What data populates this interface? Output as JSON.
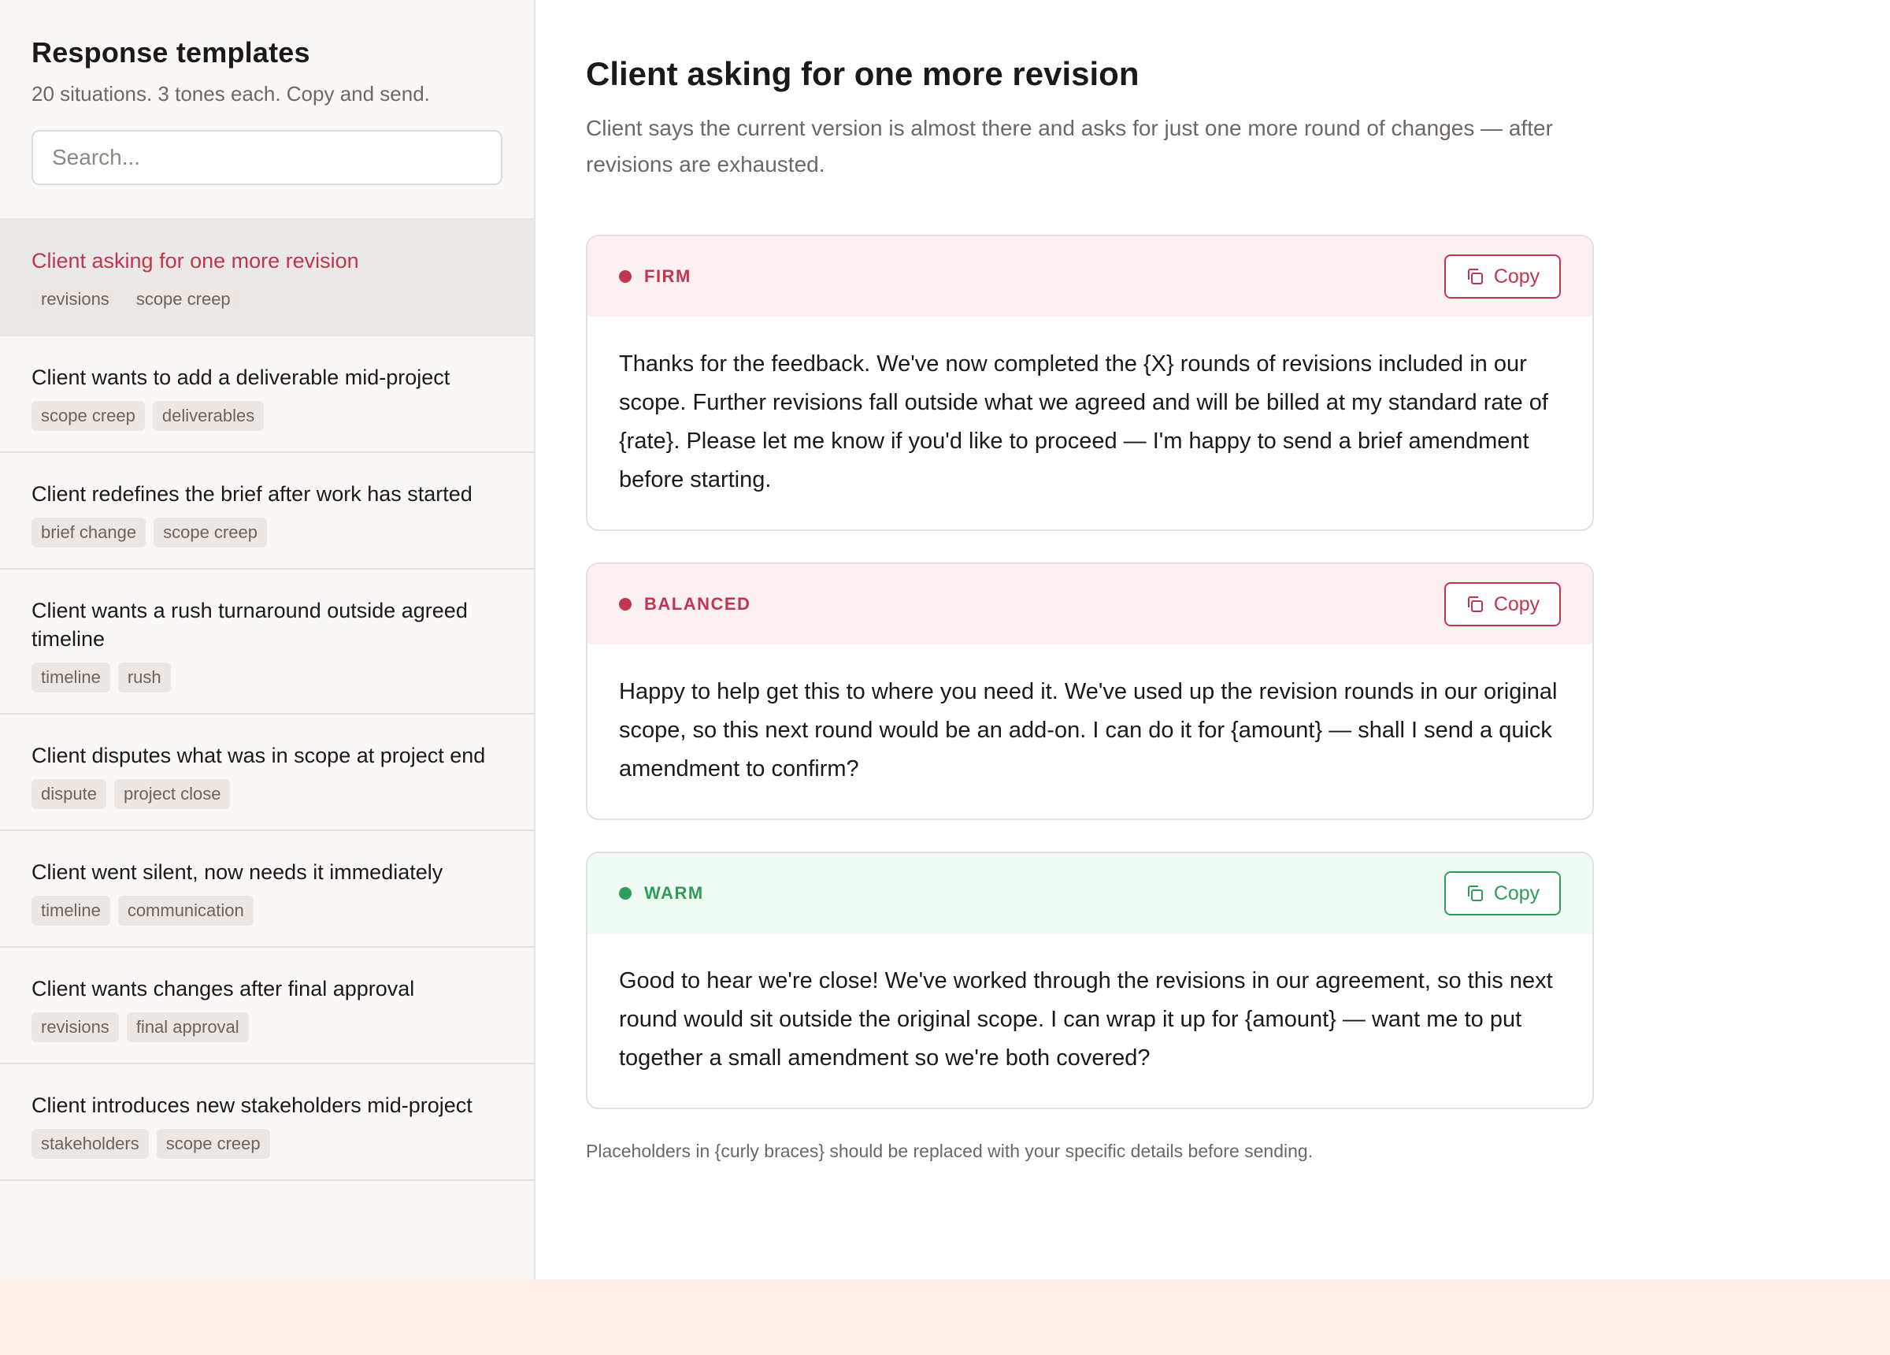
{
  "sidebar": {
    "title": "Response templates",
    "subtitle": "20 situations. 3 tones each. Copy and send.",
    "search_placeholder": "Search...",
    "items": [
      {
        "title": "Client asking for one more revision",
        "tags": [
          "revisions",
          "scope creep"
        ],
        "active": true
      },
      {
        "title": "Client wants to add a deliverable mid-project",
        "tags": [
          "scope creep",
          "deliverables"
        ]
      },
      {
        "title": "Client redefines the brief after work has started",
        "tags": [
          "brief change",
          "scope creep"
        ]
      },
      {
        "title": "Client wants a rush turnaround outside agreed timeline",
        "tags": [
          "timeline",
          "rush"
        ]
      },
      {
        "title": "Client disputes what was in scope at project end",
        "tags": [
          "dispute",
          "project close"
        ]
      },
      {
        "title": "Client went silent, now needs it immediately",
        "tags": [
          "timeline",
          "communication"
        ]
      },
      {
        "title": "Client wants changes after final approval",
        "tags": [
          "revisions",
          "final approval"
        ]
      },
      {
        "title": "Client introduces new stakeholders mid-project",
        "tags": [
          "stakeholders",
          "scope creep"
        ]
      }
    ]
  },
  "main": {
    "title": "Client asking for one more revision",
    "description": "Client says the current version is almost there and asks for just one more round of changes — after revisions are exhausted.",
    "copy_label": "Copy",
    "cards": [
      {
        "tone": "FIRM",
        "text": "Thanks for the feedback. We've now completed the {X} rounds of revisions included in our scope. Further revisions fall outside what we agreed and will be billed at my standard rate of {rate}. Please let me know if you'd like to proceed — I'm happy to send a brief amendment before starting."
      },
      {
        "tone": "BALANCED",
        "text": "Happy to help get this to where you need it. We've used up the revision rounds in our original scope, so this next round would be an add-on. I can do it for {amount} — shall I send a quick amendment to confirm?"
      },
      {
        "tone": "WARM",
        "text": "Good to hear we're close! We've worked through the revisions in our agreement, so this next round would sit outside the original scope. I can wrap it up for {amount} — want me to put together a small amendment so we're both covered?"
      }
    ],
    "footnote": "Placeholders in {curly braces} should be replaced with your specific details before sending."
  },
  "colors": {
    "accent_red": "#c0364e",
    "accent_green": "#2f9c5a",
    "firm_bg": "#fdf0f2",
    "warm_bg": "#effbf3"
  },
  "icons": {
    "copy": "copy-icon"
  }
}
